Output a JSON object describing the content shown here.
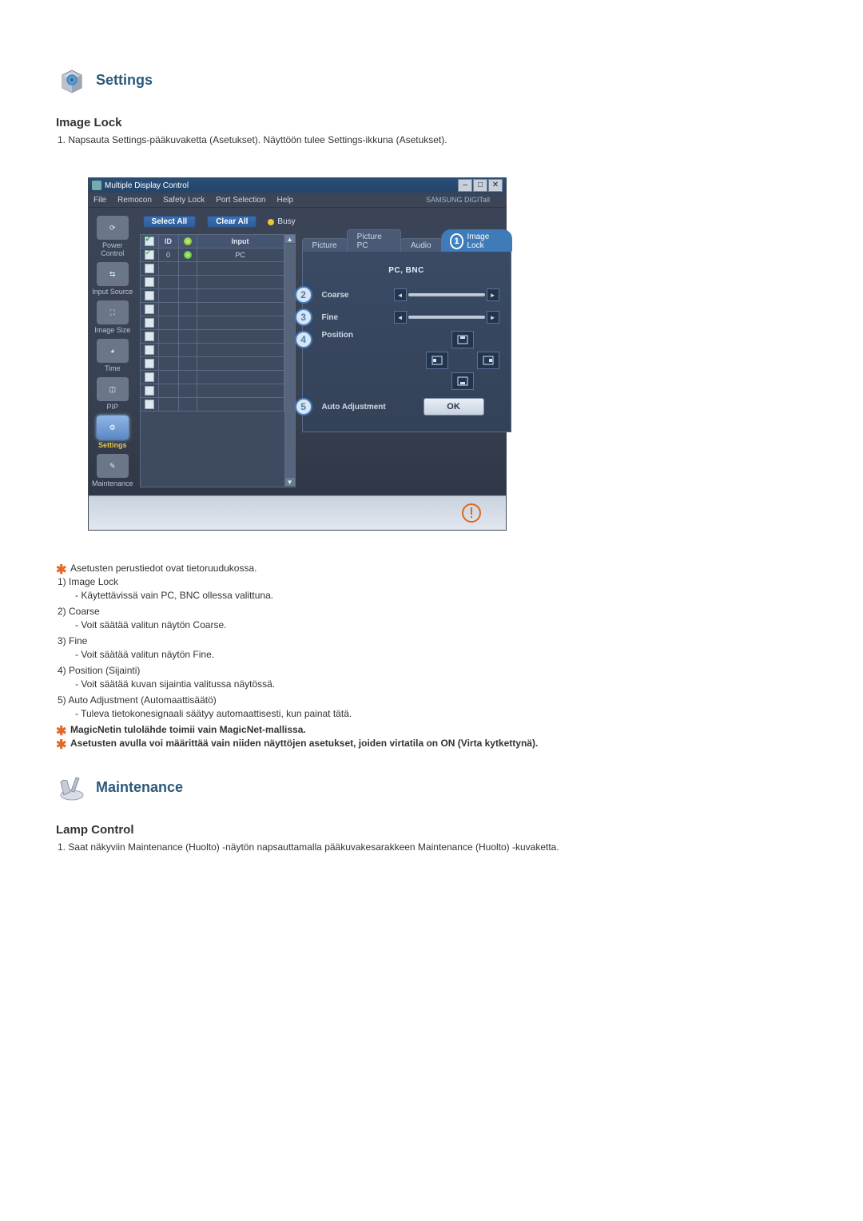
{
  "settings_section": {
    "title": "Settings",
    "subtitle": "Image Lock",
    "step1": "1.  Napsauta Settings-pääkuvaketta (Asetukset). Näyttöön tulee Settings-ikkuna (Asetukset)."
  },
  "app": {
    "title": "Multiple Display Control",
    "menu": {
      "file": "File",
      "remocon": "Remocon",
      "safety": "Safety Lock",
      "port": "Port Selection",
      "help": "Help",
      "brand": "SAMSUNG DIGITall"
    },
    "sidebar": {
      "power": "Power Control",
      "input": "Input Source",
      "size": "Image Size",
      "time": "Time",
      "pip": "PIP",
      "settings": "Settings",
      "maint": "Maintenance"
    },
    "toolbar": {
      "select_all": "Select All",
      "clear_all": "Clear All",
      "busy": "Busy"
    },
    "grid": {
      "h_id": "ID",
      "h_input": "Input",
      "row_id": "0",
      "row_input": "PC"
    },
    "tabs": {
      "picture": "Picture",
      "picture_pc": "Picture PC",
      "audio": "Audio",
      "image_lock": "Image Lock"
    },
    "panel": {
      "group": "PC, BNC",
      "coarse": "Coarse",
      "fine": "Fine",
      "position": "Position",
      "auto": "Auto Adjustment",
      "ok": "OK"
    },
    "callouts": {
      "c1": "1",
      "c2": "2",
      "c3": "3",
      "c4": "4",
      "c5": "5"
    }
  },
  "notes": {
    "n0": "Asetusten perustiedot ovat tietoruudukossa.",
    "i1_t": "1)  Image Lock",
    "i1_s": "- Käytettävissä vain PC, BNC ollessa valittuna.",
    "i2_t": "2)  Coarse",
    "i2_s": "- Voit säätää valitun näytön Coarse.",
    "i3_t": "3)  Fine",
    "i3_s": "- Voit säätää valitun näytön Fine.",
    "i4_t": "4)  Position (Sijainti)",
    "i4_s": "- Voit säätää kuvan sijaintia valitussa näytössä.",
    "i5_t": "5)  Auto Adjustment (Automaattisäätö)",
    "i5_s": "- Tuleva tietokonesignaali säätyy automaattisesti, kun painat tätä.",
    "b1": "MagicNetin tulolähde toimii vain MagicNet-mallissa.",
    "b2": "Asetusten avulla voi määrittää vain niiden näyttöjen asetukset, joiden virtatila on ON (Virta kytkettynä)."
  },
  "maint_section": {
    "title": "Maintenance",
    "subtitle": "Lamp Control",
    "step1": "1.  Saat näkyviin Maintenance (Huolto) -näytön napsauttamalla pääkuvakesarakkeen Maintenance (Huolto) -kuvaketta."
  }
}
